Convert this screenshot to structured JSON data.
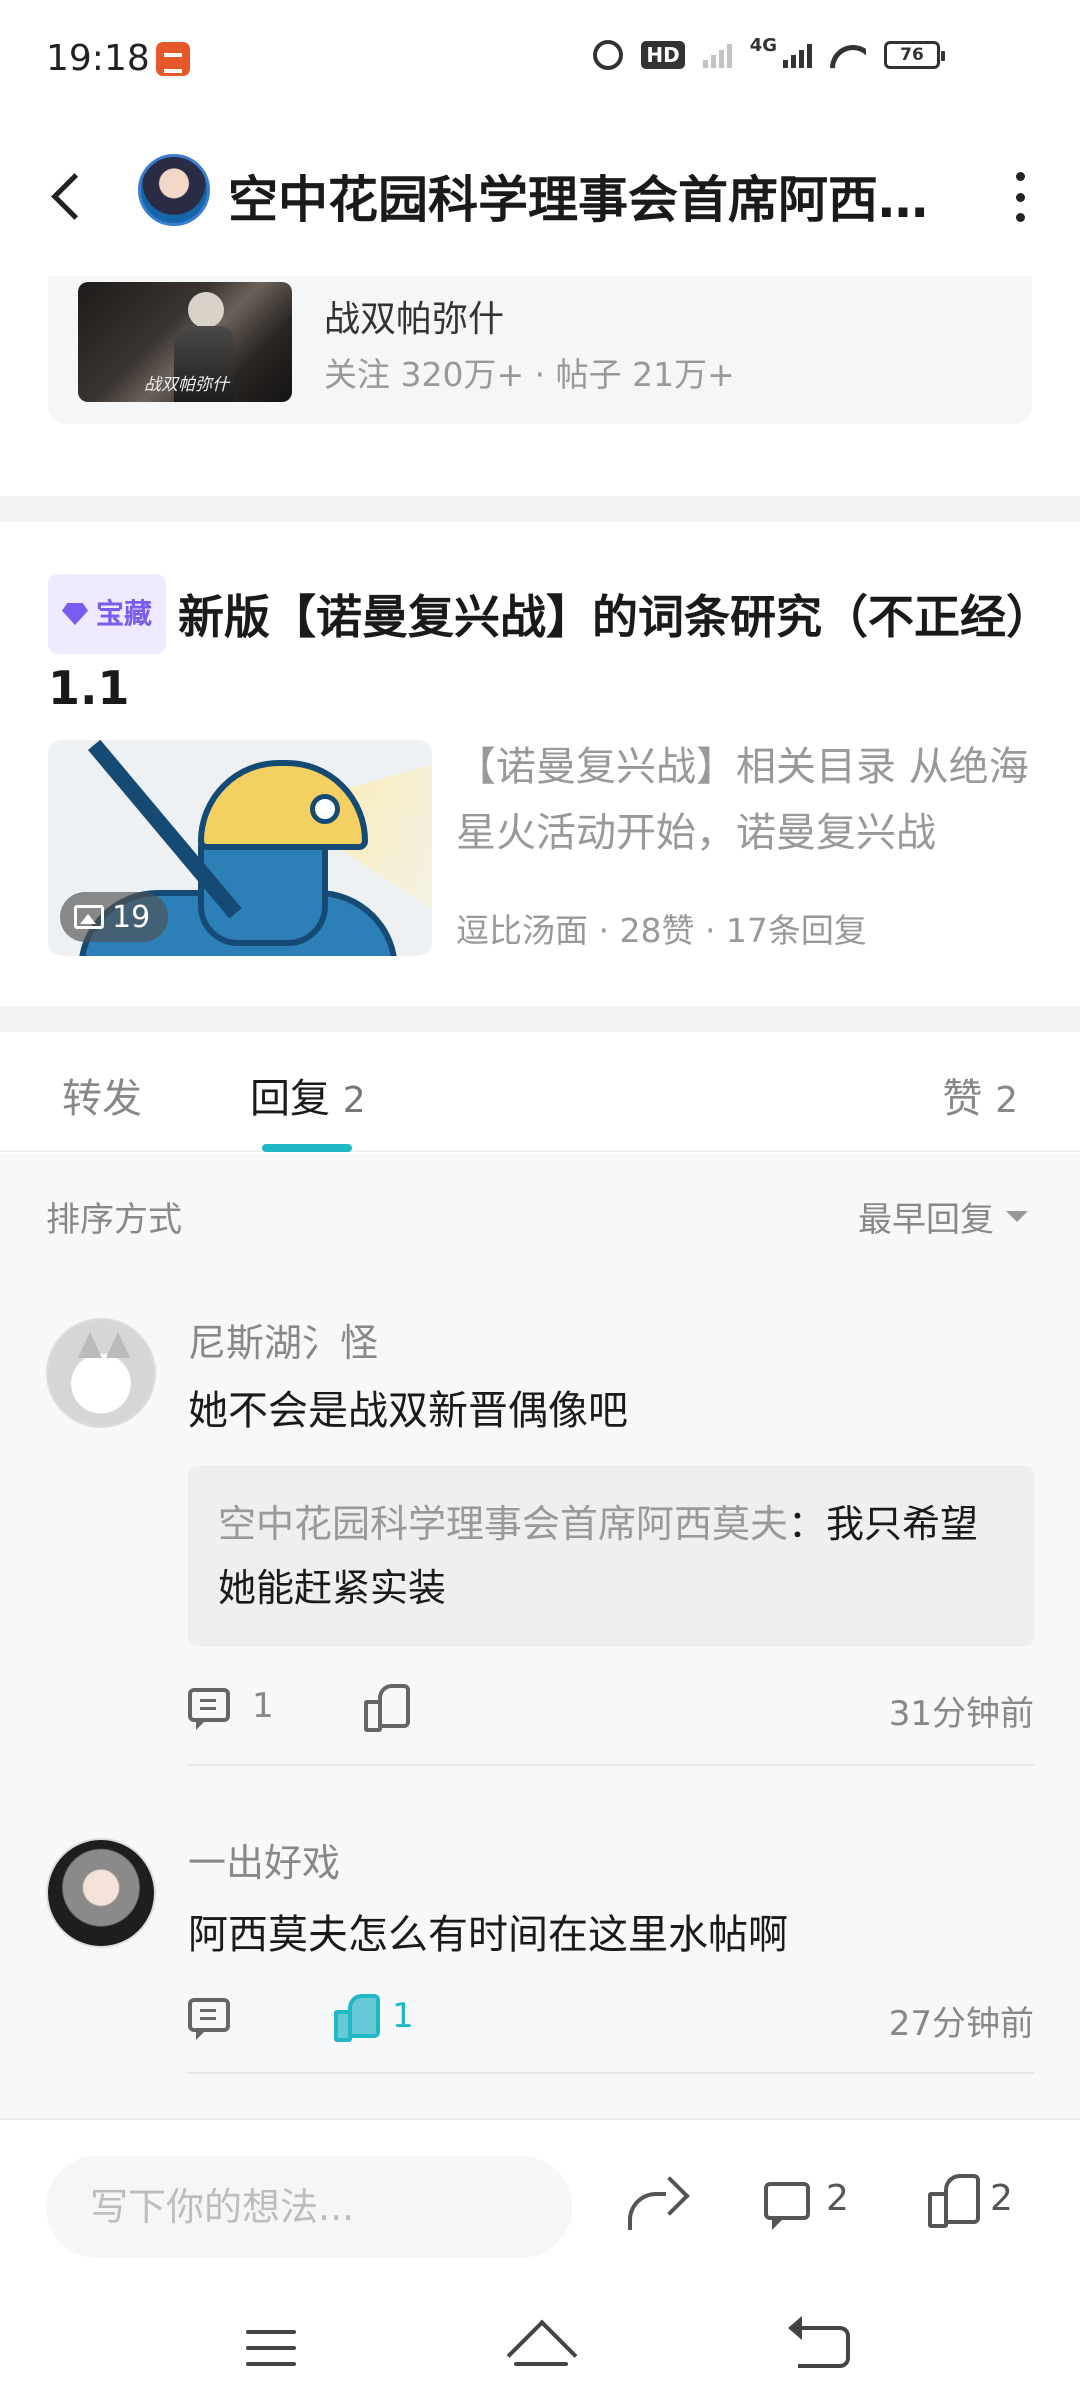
{
  "status_bar": {
    "time": "19:18",
    "hd_label": "HD",
    "network_label": "4G",
    "battery": "76"
  },
  "header": {
    "title": "空中花园科学理事会首席阿西莫夫"
  },
  "forum": {
    "name": "战双帕弥什",
    "thumb_caption": "战双帕弥什",
    "stats": "关注 320万+ · 帖子 21万+"
  },
  "post": {
    "badge": "宝藏",
    "title": "新版【诺曼复兴战】的词条研究（不正经）1.1",
    "excerpt": "【诺曼复兴战】相关目录 从绝海星火活动开始，诺曼复兴战",
    "image_count": "19",
    "meta": "逗比汤面 · 28赞 · 17条回复"
  },
  "tabs": {
    "forward": "转发",
    "reply": "回复",
    "reply_count": "2",
    "like": "赞",
    "like_count": "2"
  },
  "sort": {
    "label": "排序方式",
    "value": "最早回复"
  },
  "comments": [
    {
      "author": "尼斯湖氵怪",
      "text": "她不会是战双新晋偶像吧",
      "quote_author": "空中花园科学理事会首席阿西莫夫",
      "quote_sep": "：",
      "quote_text": "我只希望她能赶紧实装",
      "reply_count": "1",
      "like_count": "",
      "time": "31分钟前"
    },
    {
      "author": "一出好戏",
      "text": "阿西莫夫怎么有时间在这里水帖啊",
      "reply_count": "",
      "like_count": "1",
      "time": "27分钟前"
    }
  ],
  "bottom_bar": {
    "input_placeholder": "写下你的想法...",
    "comment_count": "2",
    "like_count": "2"
  },
  "colors": {
    "accent": "#1fb8c4",
    "badge_purple": "#7a5cf0",
    "liked": "#67c9d6"
  }
}
